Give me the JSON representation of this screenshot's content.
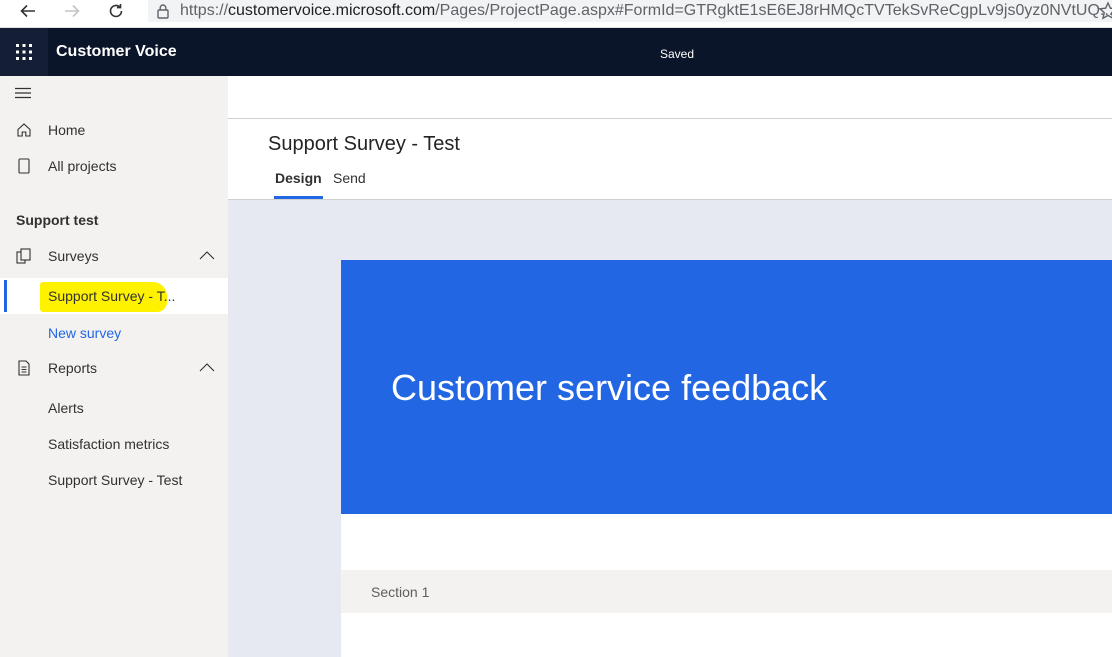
{
  "browser": {
    "url_prefix": "https://",
    "url_host": "customervoice.microsoft.com",
    "url_path": "/Pages/ProjectPage.aspx#FormId=GTRgktE1sE6EJ8rHMQcTVTekSvReCgpLv9js0yz0NVtUQ..."
  },
  "app": {
    "title": "Customer Voice",
    "status": "Saved"
  },
  "sidebar": {
    "home": "Home",
    "all_projects": "All projects",
    "project_name": "Support test",
    "surveys": "Surveys",
    "survey_items": [
      "Support Survey - T...",
      "New survey"
    ],
    "reports": "Reports",
    "report_items": [
      "Alerts",
      "Satisfaction metrics",
      "Support Survey - Test"
    ]
  },
  "main": {
    "title": "Support Survey - Test",
    "tabs": [
      "Design",
      "Send"
    ],
    "form_title": "Customer service feedback",
    "section_label": "Section 1"
  },
  "colors": {
    "accent": "#2266e3",
    "topbar": "#0a1529",
    "highlight": "#fff200"
  }
}
